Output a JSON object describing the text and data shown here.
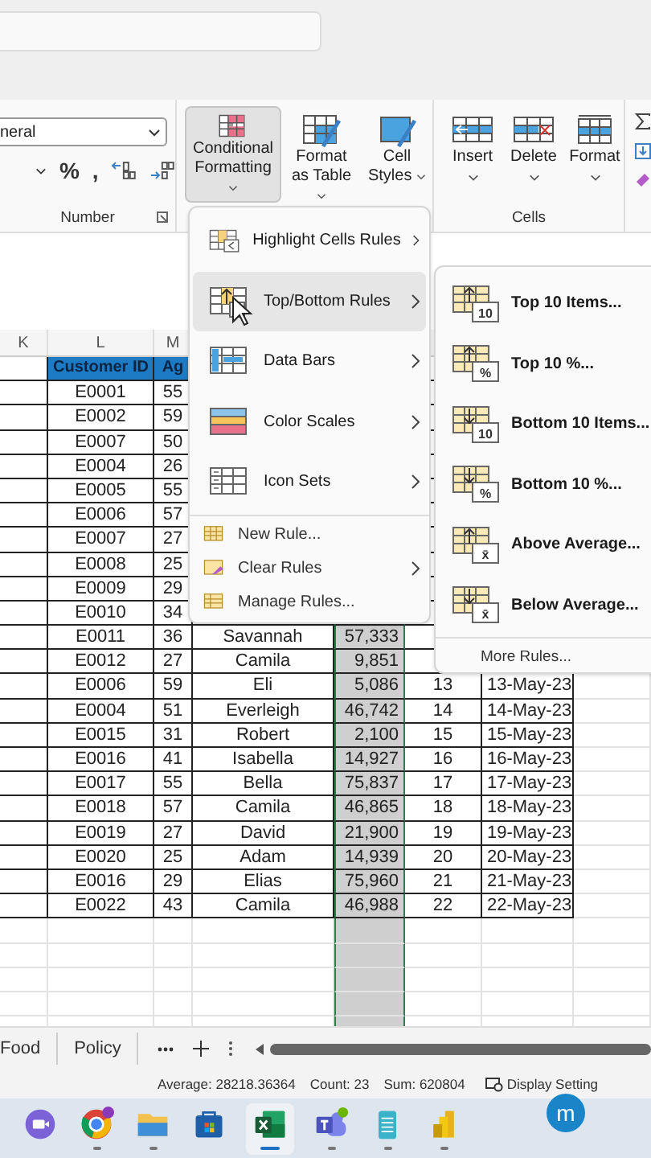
{
  "ribbon": {
    "number_format": "neral",
    "number_symbols": [
      "%",
      ","
    ],
    "number_group_label": "Number",
    "style_buttons": [
      {
        "kind": "conditional",
        "label": "Conditional Formatting",
        "selected": true
      },
      {
        "kind": "table",
        "label": "Format as Table",
        "selected": false
      },
      {
        "kind": "styles",
        "label": "Cell Styles",
        "selected": false
      }
    ],
    "cell_buttons": [
      {
        "kind": "insert",
        "label": "Insert"
      },
      {
        "kind": "delete",
        "label": "Delete"
      },
      {
        "kind": "format",
        "label": "Format"
      }
    ],
    "cells_group_label": "Cells"
  },
  "sheet": {
    "column_headers": [
      "K",
      "L",
      "M"
    ],
    "header_row": [
      "Customer ID",
      "Ag"
    ],
    "rows": [
      {
        "customer_id": "E0001",
        "age": "55"
      },
      {
        "customer_id": "E0002",
        "age": "59"
      },
      {
        "customer_id": "E0007",
        "age": "50"
      },
      {
        "customer_id": "E0004",
        "age": "26"
      },
      {
        "customer_id": "E0005",
        "age": "55"
      },
      {
        "customer_id": "E0006",
        "age": "57"
      },
      {
        "customer_id": "E0007",
        "age": "27"
      },
      {
        "customer_id": "E0008",
        "age": "25"
      },
      {
        "customer_id": "E0009",
        "age": "29"
      },
      {
        "customer_id": "E0010",
        "age": "34"
      },
      {
        "customer_id": "E0011",
        "age": "36",
        "column_3": "Savannah",
        "column_4": "57,333"
      },
      {
        "customer_id": "E0012",
        "age": "27",
        "column_3": "Camila",
        "column_4": "9,851"
      },
      {
        "customer_id": "E0006",
        "age": "59",
        "column_3": "Eli",
        "column_4": "5,086",
        "column_5": "13",
        "column_6": "13-May-23"
      },
      {
        "customer_id": "E0004",
        "age": "51",
        "column_3": "Everleigh",
        "column_4": "46,742",
        "column_5": "14",
        "column_6": "14-May-23"
      },
      {
        "customer_id": "E0015",
        "age": "31",
        "column_3": "Robert",
        "column_4": "2,100",
        "column_5": "15",
        "column_6": "15-May-23"
      },
      {
        "customer_id": "E0016",
        "age": "41",
        "column_3": "Isabella",
        "column_4": "14,927",
        "column_5": "16",
        "column_6": "16-May-23"
      },
      {
        "customer_id": "E0017",
        "age": "55",
        "column_3": "Bella",
        "column_4": "75,837",
        "column_5": "17",
        "column_6": "17-May-23"
      },
      {
        "customer_id": "E0018",
        "age": "57",
        "column_3": "Camila",
        "column_4": "46,865",
        "column_5": "18",
        "column_6": "18-May-23"
      },
      {
        "customer_id": "E0019",
        "age": "27",
        "column_3": "David",
        "column_4": "21,900",
        "column_5": "19",
        "column_6": "19-May-23"
      },
      {
        "customer_id": "E0020",
        "age": "25",
        "column_3": "Adam",
        "column_4": "14,939",
        "column_5": "20",
        "column_6": "20-May-23"
      },
      {
        "customer_id": "E0016",
        "age": "29",
        "column_3": "Elias",
        "column_4": "75,960",
        "column_5": "21",
        "column_6": "21-May-23"
      },
      {
        "customer_id": "E0022",
        "age": "43",
        "column_3": "Camila",
        "column_4": "46,988",
        "column_5": "22",
        "column_6": "22-May-23"
      }
    ]
  },
  "menu": {
    "items": [
      {
        "kind": "highlight",
        "label": "Highlight Cells Rules",
        "has_submenu": true,
        "selected": false
      },
      {
        "kind": "top_bottom",
        "label": "Top/Bottom Rules",
        "has_submenu": true,
        "selected": true
      },
      {
        "kind": "data_bars",
        "label": "Data Bars",
        "has_submenu": true,
        "selected": false
      },
      {
        "kind": "color_scales",
        "label": "Color Scales",
        "has_submenu": true,
        "selected": false
      },
      {
        "kind": "icon_sets",
        "label": "Icon Sets",
        "has_submenu": true,
        "selected": false
      },
      {
        "kind": "new_rule",
        "label": "New Rule...",
        "has_submenu": false,
        "selected": false
      },
      {
        "kind": "clear_rules",
        "label": "Clear Rules",
        "has_submenu": true,
        "selected": false
      },
      {
        "kind": "manage_rules",
        "label": "Manage Rules...",
        "has_submenu": false,
        "selected": false
      }
    ]
  },
  "submenu": {
    "items": [
      {
        "kind": "top",
        "label": "Top 10 Items...",
        "icon_label": "10"
      },
      {
        "kind": "top",
        "label": "Top 10 %...",
        "icon_label": "%"
      },
      {
        "kind": "bottom",
        "label": "Bottom 10 Items...",
        "icon_label": "10"
      },
      {
        "kind": "bottom",
        "label": "Bottom 10 %...",
        "icon_label": "%"
      },
      {
        "kind": "top",
        "label": "Above Average...",
        "icon_label": "x̄"
      },
      {
        "kind": "bottom",
        "label": "Below Average...",
        "icon_label": "x̄"
      }
    ],
    "footer": "More Rules..."
  },
  "sheet_tabs": [
    {
      "label": "Food",
      "selected": false
    },
    {
      "label": "Policy",
      "selected": false
    }
  ],
  "status_bar": {
    "average": "Average: 28218.36364",
    "count": "Count: 23",
    "sum": "Sum: 620804",
    "display_settings": "Display Setting"
  },
  "taskbar": {
    "items": [
      {
        "kind": "video",
        "running": false,
        "selected": false
      },
      {
        "kind": "browser",
        "running": true,
        "selected": false
      },
      {
        "kind": "folder",
        "running": true,
        "selected": false
      },
      {
        "kind": "store",
        "running": false,
        "selected": false
      },
      {
        "kind": "sheets",
        "running": true,
        "selected": true
      },
      {
        "kind": "chat",
        "running": true,
        "selected": false
      },
      {
        "kind": "notes",
        "running": true,
        "selected": false
      },
      {
        "kind": "bars",
        "running": true,
        "selected": false
      }
    ],
    "avatar": "m"
  }
}
